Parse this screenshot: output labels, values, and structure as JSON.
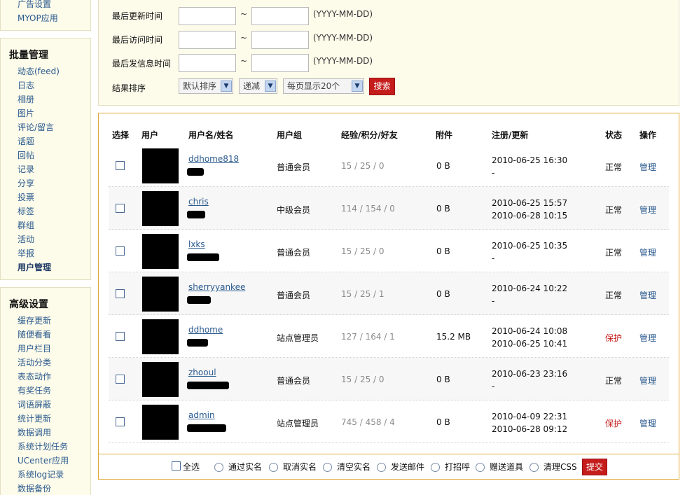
{
  "sidebar": {
    "top_items": [
      "广告设置",
      "MYOP应用"
    ],
    "batch": {
      "title": "批量管理",
      "items": [
        "动态(feed)",
        "日志",
        "相册",
        "图片",
        "评论/留言",
        "话题",
        "回帖",
        "记录",
        "分享",
        "投票",
        "标签",
        "群组",
        "活动",
        "举报",
        "用户管理"
      ],
      "active": "用户管理"
    },
    "advanced": {
      "title": "高级设置",
      "items": [
        "缓存更新",
        "随便看看",
        "用户栏目",
        "活动分类",
        "表态动作",
        "有奖任务",
        "词语屏蔽",
        "统计更新",
        "数据调用",
        "系统计划任务",
        "UCenter应用",
        "系统log记录",
        "数据备份"
      ]
    }
  },
  "filter": {
    "rows": [
      {
        "label": "最后更新时间",
        "from": "",
        "to": "",
        "sep": "~",
        "hint": "(YYYY-MM-DD)"
      },
      {
        "label": "最后访问时间",
        "from": "",
        "to": "",
        "sep": "~",
        "hint": "(YYYY-MM-DD)"
      },
      {
        "label": "最后发信息时间",
        "from": "",
        "to": "",
        "sep": "~",
        "hint": "(YYYY-MM-DD)"
      }
    ],
    "sort_label": "结果排序",
    "sort_field": "默认排序",
    "sort_order": "递减",
    "page_size": "每页显示20个",
    "search_label": "搜索"
  },
  "table": {
    "headers": {
      "select": "选择",
      "user": "用户",
      "name": "用户名/姓名",
      "group": "用户组",
      "stats": "经验/积分/好友",
      "attach": "附件",
      "reg": "注册/更新",
      "status": "状态",
      "op": "操作"
    },
    "rows": [
      {
        "username": "ddhome818",
        "group": "普通会员",
        "stats": "15 / 25 / 0",
        "attach": "0 B",
        "reg": "2010-06-25 16:30",
        "update": "-",
        "status": "正常",
        "op": "管理"
      },
      {
        "username": "chris",
        "group": "中级会员",
        "stats": "114 / 154 / 0",
        "attach": "0 B",
        "reg": "2010-06-25 15:57",
        "update": "2010-06-28 10:15",
        "status": "正常",
        "op": "管理"
      },
      {
        "username": "lxks",
        "group": "普通会员",
        "stats": "15 / 25 / 0",
        "attach": "0 B",
        "reg": "2010-06-25 10:35",
        "update": "-",
        "status": "正常",
        "op": "管理"
      },
      {
        "username": "sherryyankee",
        "group": "普通会员",
        "stats": "15 / 25 / 1",
        "attach": "0 B",
        "reg": "2010-06-24 10:22",
        "update": "-",
        "status": "正常",
        "op": "管理"
      },
      {
        "username": "ddhome",
        "group": "站点管理员",
        "stats": "127 / 164 / 1",
        "attach": "15.2 MB",
        "reg": "2010-06-24 10:08",
        "update": "2010-06-25 10:41",
        "status": "保护",
        "op": "管理"
      },
      {
        "username": "zhooul",
        "group": "普通会员",
        "stats": "15 / 25 / 0",
        "attach": "0 B",
        "reg": "2010-06-23 23:16",
        "update": "-",
        "status": "正常",
        "op": "管理"
      },
      {
        "username": "admin",
        "group": "站点管理员",
        "stats": "745 / 458 / 4",
        "attach": "0 B",
        "reg": "2010-04-09 22:31",
        "update": "2010-06-28 09:12",
        "status": "保护",
        "op": "管理"
      }
    ]
  },
  "footer": {
    "select_all": "全选",
    "actions": [
      "通过实名",
      "取消实名",
      "清空实名",
      "发送邮件",
      "打招呼",
      "赠送道具",
      "清理CSS"
    ],
    "submit": "提交"
  },
  "colors": {
    "accent_red": "#c51c1c",
    "link": "#2a5a8e",
    "panel_border": "#e2a83a",
    "panel_bg": "#fdfbea"
  }
}
